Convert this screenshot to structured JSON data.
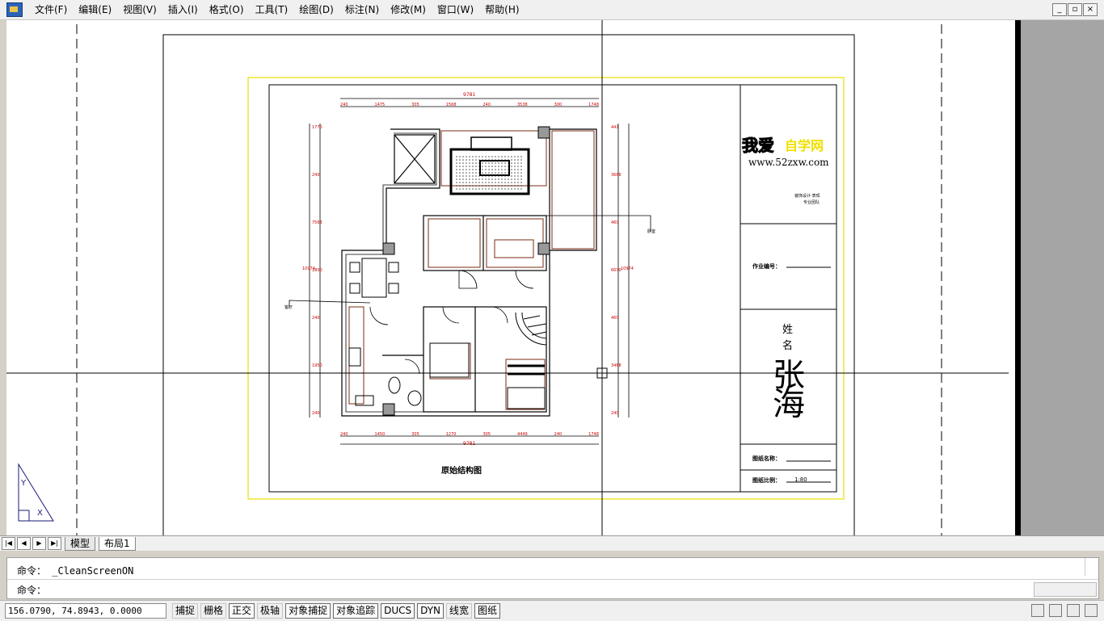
{
  "menu": {
    "items": [
      "文件(F)",
      "编辑(E)",
      "视图(V)",
      "插入(I)",
      "格式(O)",
      "工具(T)",
      "绘图(D)",
      "标注(N)",
      "修改(M)",
      "窗口(W)",
      "帮助(H)"
    ]
  },
  "window_buttons": {
    "minimize": "_",
    "restore": "▫",
    "close": "×"
  },
  "drawing": {
    "title": "原始结构图",
    "top_total": "9781",
    "top_dims": [
      "240",
      "1475",
      "305",
      "1568",
      "240",
      "3538",
      "300",
      "1748"
    ],
    "bottom_total": "9781",
    "bottom_dims": [
      "240",
      "1450",
      "305",
      "1270",
      "305",
      "4449",
      "240",
      "1748"
    ],
    "left_dims": [
      "1770",
      "240",
      "7563",
      "1800",
      "240",
      "1950",
      "240"
    ],
    "left_total": "10974",
    "right_dims": [
      "441",
      "3666",
      "460",
      "6670",
      "460",
      "3468",
      "240"
    ],
    "right_total": "10974",
    "label_left": "客厅",
    "label_right": "卧室"
  },
  "title_block": {
    "logo_main": "我爱",
    "logo_accent": "自学网",
    "logo_url": "www.52zxw.com",
    "small_text_1": "装饰设计·表现",
    "small_text_2": "专业团队",
    "job_label": "作业编号：",
    "name_label_1": "姓",
    "name_label_2": "名",
    "signature": "张海",
    "drawing_name_label": "图纸名称：",
    "scale_label": "图纸比例：",
    "scale_value": "1:80"
  },
  "ucs": {
    "x": "X",
    "y": "Y"
  },
  "tabs": {
    "nav": [
      "|◀",
      "◀",
      "▶",
      "▶|"
    ],
    "model": "模型",
    "layout": "布局1"
  },
  "command": {
    "history": "命令： _CleanScreenON",
    "prompt": "命令："
  },
  "status": {
    "coords": "156.0790, 74.8943, 0.0000",
    "buttons": [
      {
        "label": "捕捉",
        "active": false
      },
      {
        "label": "栅格",
        "active": false
      },
      {
        "label": "正交",
        "active": true
      },
      {
        "label": "极轴",
        "active": false
      },
      {
        "label": "对象捕捉",
        "active": true
      },
      {
        "label": "对象追踪",
        "active": true
      },
      {
        "label": "DUCS",
        "active": true
      },
      {
        "label": "DYN",
        "active": true
      },
      {
        "label": "线宽",
        "active": false
      },
      {
        "label": "图纸",
        "active": true
      }
    ]
  },
  "colors": {
    "dim_red": "#cc0000",
    "wall_brown": "#7a2b12",
    "yellow_frame": "#e8e000",
    "logo_yellow": "#f0e000"
  }
}
